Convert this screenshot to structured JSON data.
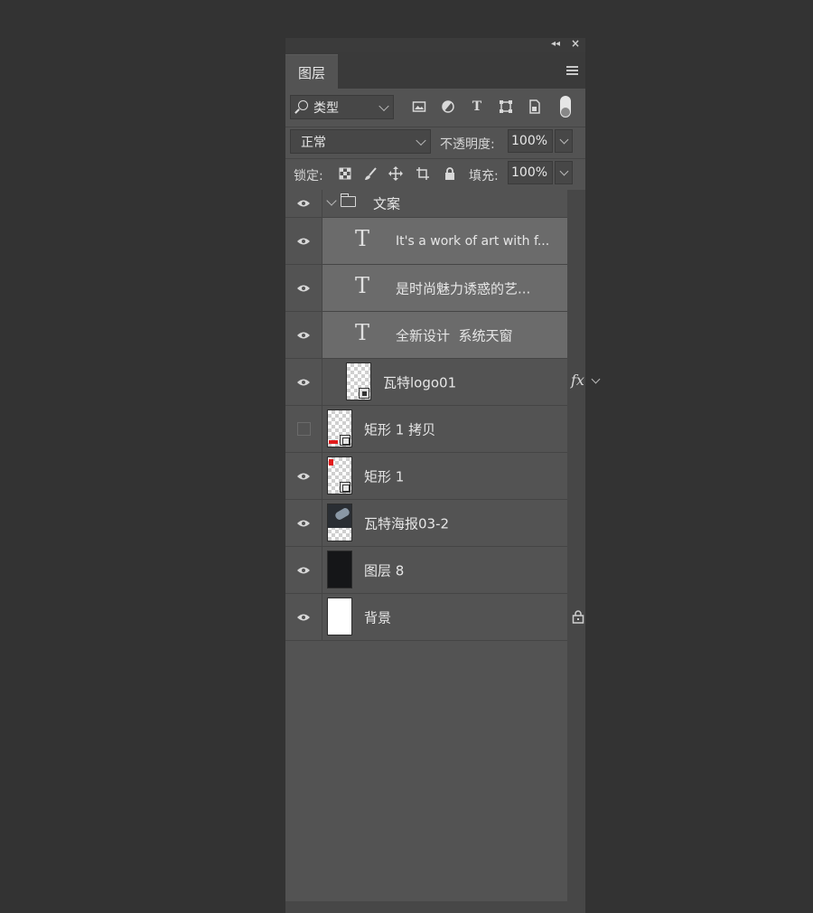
{
  "panel": {
    "tab_label": "图层",
    "filter": {
      "kind_label": "类型"
    },
    "blend": {
      "mode": "正常",
      "opacity_label": "不透明度:",
      "opacity_value": "100%"
    },
    "lock": {
      "lock_label": "锁定:",
      "fill_label": "填充:",
      "fill_value": "100%"
    }
  },
  "layers": [
    {
      "name": "文案",
      "kind": "group",
      "visible": true
    },
    {
      "name": "It's a work of art with f...",
      "kind": "text",
      "visible": true,
      "selected": true
    },
    {
      "name": "是时尚魅力诱惑的艺...",
      "kind": "text",
      "visible": true,
      "selected": true
    },
    {
      "name": "全新设计  系统天窗",
      "kind": "text",
      "visible": true,
      "selected": true
    },
    {
      "name": "瓦特logo01",
      "kind": "smart",
      "visible": true,
      "effects_label": "fx"
    },
    {
      "name": "矩形 1 拷贝",
      "kind": "shape",
      "visible": false
    },
    {
      "name": "矩形 1",
      "kind": "shape",
      "visible": true
    },
    {
      "name": "瓦特海报03-2",
      "kind": "image",
      "visible": true
    },
    {
      "name": "图层 8",
      "kind": "pixel",
      "visible": true
    },
    {
      "name": "背景",
      "kind": "background",
      "visible": true,
      "locked": true
    }
  ]
}
